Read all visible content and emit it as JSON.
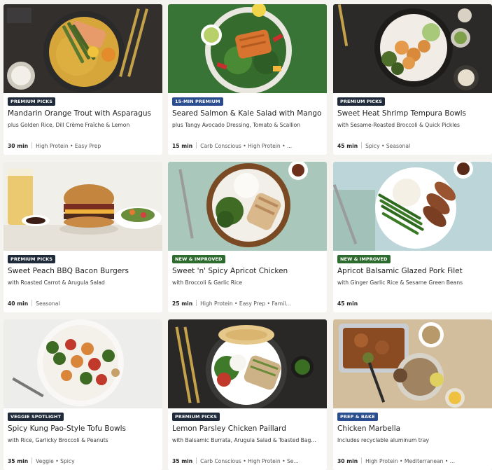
{
  "colors": {
    "premium": "#1f2b3a",
    "fifteen_min": "#2a4d8f",
    "new_improved": "#2e6b2e",
    "veggie": "#1f2b3a",
    "prep_bake": "#2a4d8f"
  },
  "cards": [
    {
      "badge": "PREMIUM PICKS",
      "badge_color": "#1f2b3a",
      "title": "Mandarin Orange Trout with Asparagus",
      "subtitle": "plus Golden Rice, Dill Crème Fraîche & Lemon",
      "time": "30 min",
      "tags": "High Protein • Easy Prep",
      "photo": "trout"
    },
    {
      "badge": "15-MIN PREMIUM",
      "badge_color": "#2a4d8f",
      "title": "Seared Salmon & Kale Salad with Mango",
      "subtitle": "plus Tangy Avocado Dressing, Tomato & Scallion",
      "time": "15 min",
      "tags": "Carb Conscious • High Protein • ...",
      "photo": "salmon"
    },
    {
      "badge": "PREMIUM PICKS",
      "badge_color": "#1f2b3a",
      "title": "Sweet Heat Shrimp Tempura Bowls",
      "subtitle": "with Sesame-Roasted Broccoli & Quick Pickles",
      "time": "45 min",
      "tags": "Spicy • Seasonal",
      "photo": "shrimp"
    },
    {
      "badge": "PREMIUM PICKS",
      "badge_color": "#1f2b3a",
      "title": "Sweet Peach BBQ Bacon Burgers",
      "subtitle": "with Roasted Carrot & Arugula Salad",
      "time": "40 min",
      "tags": "Seasonal",
      "photo": "burger"
    },
    {
      "badge": "NEW & IMPROVED",
      "badge_color": "#2e6b2e",
      "title": "Sweet 'n' Spicy Apricot Chicken",
      "subtitle": "with Broccoli & Garlic Rice",
      "time": "25 min",
      "tags": "High Protein • Easy Prep • Famil...",
      "photo": "apricot"
    },
    {
      "badge": "NEW & IMPROVED",
      "badge_color": "#2e6b2e",
      "title": "Apricot Balsamic Glazed Pork Filet",
      "subtitle": "with Ginger Garlic Rice & Sesame Green Beans",
      "time": "45 min",
      "tags": "",
      "photo": "pork"
    },
    {
      "badge": "VEGGIE SPOTLIGHT",
      "badge_color": "#1f2b3a",
      "title": "Spicy Kung Pao-Style Tofu Bowls",
      "subtitle": "with Rice, Garlicky Broccoli & Peanuts",
      "time": "35 min",
      "tags": "Veggie • Spicy",
      "photo": "tofu"
    },
    {
      "badge": "PREMIUM PICKS",
      "badge_color": "#1f2b3a",
      "title": "Lemon Parsley Chicken Paillard",
      "subtitle": "with Balsamic Burrata, Arugula Salad & Toasted Bag...",
      "time": "35 min",
      "tags": "Carb Conscious • High Protein • Se...",
      "photo": "paillard"
    },
    {
      "badge": "PREP & BAKE",
      "badge_color": "#2a4d8f",
      "title": "Chicken Marbella",
      "subtitle": "Includes recyclable aluminum tray",
      "time": "30 min",
      "tags": "High Protein • Mediterranean • ...",
      "photo": "marbella"
    }
  ]
}
